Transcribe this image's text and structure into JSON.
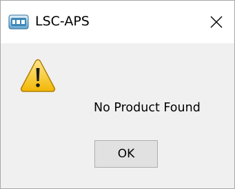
{
  "window": {
    "title": "LSC-APS",
    "app_icon": "lsc-aps-app-icon",
    "close_icon": "close-icon"
  },
  "content": {
    "icon": "warning-icon",
    "message": "No Product Found"
  },
  "buttons": {
    "ok_label": "OK"
  },
  "colors": {
    "titlebar_bg": "#ffffff",
    "dialog_bg": "#f0f0f0",
    "button_bg": "#e1e1e1",
    "button_border": "#adadad",
    "warning_yellow": "#f6c31a"
  }
}
